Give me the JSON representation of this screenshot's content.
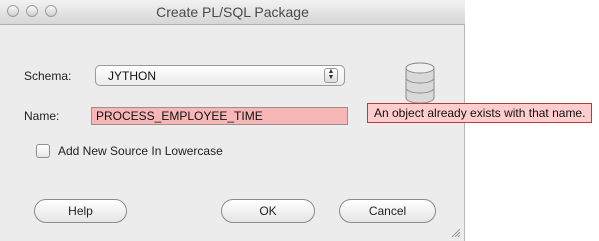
{
  "window": {
    "title": "Create PL/SQL Package"
  },
  "form": {
    "schema_label": "Schema:",
    "schema_value": "JYTHON",
    "name_label": "Name:",
    "name_value": "PROCESS_EMPLOYEE_TIME",
    "lowercase_label": "Add New Source In Lowercase",
    "lowercase_checked": false
  },
  "tooltip": {
    "text": "An object already exists with that name."
  },
  "buttons": {
    "help": "Help",
    "ok": "OK",
    "cancel": "Cancel"
  },
  "icons": {
    "database": "database-icon",
    "dropdown": "up-down-arrows-icon",
    "resize": "resize-grip-icon"
  },
  "colors": {
    "error_field": "#f7b7b7",
    "tooltip_bg": "#ffcdcd",
    "tooltip_border": "#b53a3a"
  }
}
